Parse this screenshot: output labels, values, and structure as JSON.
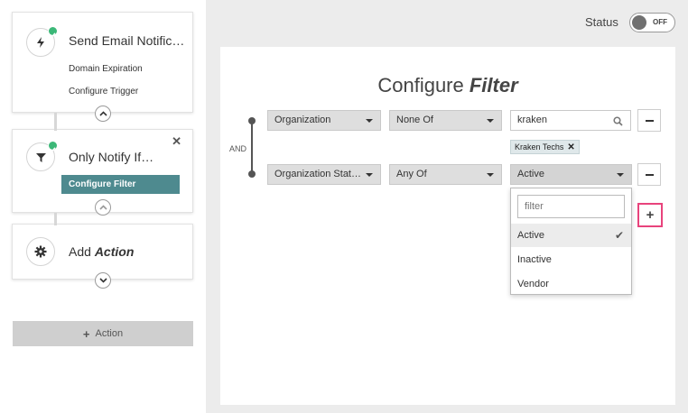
{
  "workflow": {
    "step1": {
      "title": "Send Email Notific…",
      "items": [
        "Domain Expiration",
        "Configure Trigger"
      ],
      "icon": "bolt-icon",
      "badge": "check-badge"
    },
    "step2": {
      "title": "Only Notify If…",
      "button_label": "Configure Filter",
      "icon": "funnel-icon",
      "close_label": "✕"
    },
    "step3": {
      "title_prefix": "Add ",
      "title_emphasis": "Action",
      "icon": "gear-icon"
    },
    "add_action_label": "Action"
  },
  "status": {
    "label": "Status",
    "toggle_text": "OFF"
  },
  "filter_panel": {
    "title_prefix": "Configure ",
    "title_emphasis": "Filter",
    "logic_label": "AND",
    "rows": [
      {
        "field": "Organization",
        "operator": "None Of",
        "value": "kraken",
        "tags": [
          "Kraken Techs"
        ]
      },
      {
        "field": "Organization Stat…",
        "operator": "Any Of",
        "value": "Active"
      }
    ],
    "dropdown": {
      "placeholder": "filter",
      "options": [
        "Active",
        "Inactive",
        "Vendor"
      ],
      "selected": "Active"
    }
  },
  "colors": {
    "accent_teal": "#4e8a8f",
    "success_green": "#3cb878",
    "highlight_pink": "#e8437c"
  }
}
